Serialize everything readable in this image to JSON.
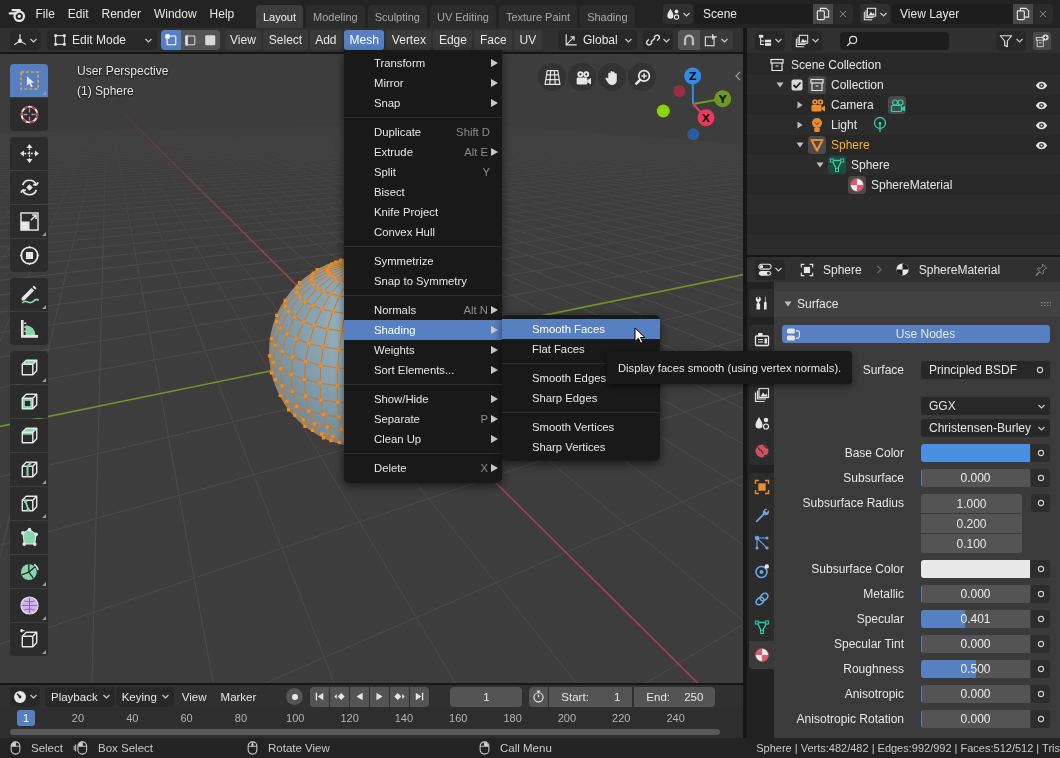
{
  "topbar": {
    "menus": [
      "File",
      "Edit",
      "Render",
      "Window",
      "Help"
    ],
    "workspaces": [
      {
        "label": "Layout",
        "selected": true
      },
      {
        "label": "Modeling",
        "selected": false
      },
      {
        "label": "Sculpting",
        "selected": false
      },
      {
        "label": "UV Editing",
        "selected": false
      },
      {
        "label": "Texture Paint",
        "selected": false
      },
      {
        "label": "Shading",
        "selected": false
      }
    ],
    "scene": "Scene",
    "view_layer": "View Layer"
  },
  "viewport_header": {
    "mode": "Edit Mode",
    "select_modes": [
      {
        "kind": "vertex",
        "selected": true
      },
      {
        "kind": "edge",
        "selected": false
      },
      {
        "kind": "face",
        "selected": false
      }
    ],
    "menus": [
      {
        "label": "View",
        "selected": false
      },
      {
        "label": "Select",
        "selected": false
      },
      {
        "label": "Add",
        "selected": false
      },
      {
        "label": "Mesh",
        "selected": true
      },
      {
        "label": "Vertex",
        "selected": false
      },
      {
        "label": "Edge",
        "selected": false
      },
      {
        "label": "Face",
        "selected": false
      },
      {
        "label": "UV",
        "selected": false
      }
    ],
    "orientation": "Global"
  },
  "viewport": {
    "view_name": "User Perspective",
    "object_name": "(1) Sphere",
    "tool_groups": [
      [
        {
          "kind": "select-box",
          "selected": true
        },
        {
          "kind": "cursor",
          "selected": false
        }
      ],
      [
        {
          "kind": "move",
          "selected": false
        },
        {
          "kind": "rotate",
          "selected": false
        },
        {
          "kind": "scale",
          "selected": false
        },
        {
          "kind": "transform",
          "selected": false
        }
      ],
      [
        {
          "kind": "annotate",
          "selected": false
        },
        {
          "kind": "measure",
          "selected": false
        }
      ],
      [
        {
          "kind": "extrude",
          "selected": false
        },
        {
          "kind": "inset",
          "selected": false
        },
        {
          "kind": "bevel",
          "selected": false
        },
        {
          "kind": "loop-cut",
          "selected": false
        },
        {
          "kind": "knife",
          "selected": false
        },
        {
          "kind": "poly-build",
          "selected": false
        },
        {
          "kind": "spin",
          "selected": false
        },
        {
          "kind": "smooth",
          "selected": false
        },
        {
          "kind": "edge-slide",
          "selected": false
        }
      ]
    ],
    "axes": [
      {
        "label": "Z",
        "color": "#2f8cec"
      },
      {
        "label": "Y",
        "color": "#6a9a1f"
      },
      {
        "label": "X",
        "color": "#f2385a"
      }
    ]
  },
  "mesh_menu": {
    "sections": [
      [
        {
          "label": "Transform",
          "submenu": true,
          "selected": false
        },
        {
          "label": "Mirror",
          "submenu": true,
          "selected": false
        },
        {
          "label": "Snap",
          "submenu": true,
          "selected": false
        }
      ],
      [
        {
          "label": "Duplicate",
          "shortcut": "Shift D",
          "submenu": false,
          "selected": false
        },
        {
          "label": "Extrude",
          "shortcut": "Alt E",
          "submenu": true,
          "selected": false
        },
        {
          "label": "Split",
          "shortcut": "Y",
          "submenu": false,
          "selected": false
        },
        {
          "label": "Bisect",
          "submenu": false,
          "selected": false
        },
        {
          "label": "Knife Project",
          "submenu": false,
          "selected": false
        },
        {
          "label": "Convex Hull",
          "submenu": false,
          "selected": false
        }
      ],
      [
        {
          "label": "Symmetrize",
          "submenu": false,
          "selected": false
        },
        {
          "label": "Snap to Symmetry",
          "submenu": false,
          "selected": false
        }
      ],
      [
        {
          "label": "Normals",
          "shortcut": "Alt N",
          "submenu": true,
          "selected": false
        },
        {
          "label": "Shading",
          "submenu": true,
          "selected": true
        },
        {
          "label": "Weights",
          "submenu": true,
          "selected": false
        },
        {
          "label": "Sort Elements...",
          "submenu": true,
          "selected": false
        }
      ],
      [
        {
          "label": "Show/Hide",
          "submenu": true,
          "selected": false
        },
        {
          "label": "Separate",
          "shortcut": "P",
          "submenu": true,
          "selected": false
        },
        {
          "label": "Clean Up",
          "submenu": true,
          "selected": false
        }
      ],
      [
        {
          "label": "Delete",
          "shortcut": "X",
          "submenu": true,
          "selected": false
        }
      ]
    ]
  },
  "shading_submenu": {
    "sections": [
      [
        {
          "label": "Smooth Faces",
          "selected": true
        },
        {
          "label": "Flat Faces",
          "selected": false
        }
      ],
      [
        {
          "label": "Smooth Edges",
          "selected": false
        },
        {
          "label": "Sharp Edges",
          "selected": false
        }
      ],
      [
        {
          "label": "Smooth Vertices",
          "selected": false
        },
        {
          "label": "Sharp Vertices",
          "selected": false
        }
      ]
    ]
  },
  "tooltip": "Display faces smooth (using vertex normals).",
  "outliner": {
    "tree": [
      {
        "kind": "scene-collection",
        "label": "Scene Collection",
        "selected": false,
        "children": [
          {
            "kind": "collection",
            "label": "Collection",
            "expanded": true,
            "checked": true,
            "selected": false,
            "children": [
              {
                "kind": "camera",
                "label": "Camera",
                "expanded": false,
                "selected": false
              },
              {
                "kind": "light",
                "label": "Light",
                "expanded": false,
                "selected": false
              },
              {
                "kind": "mesh-object",
                "label": "Sphere",
                "expanded": true,
                "selected": true,
                "children": [
                  {
                    "kind": "mesh-data",
                    "label": "Sphere",
                    "expanded": true,
                    "selected": false,
                    "children": [
                      {
                        "kind": "material",
                        "label": "SphereMaterial",
                        "selected": false
                      }
                    ]
                  }
                ]
              }
            ]
          }
        ]
      }
    ]
  },
  "properties": {
    "object": "Sphere",
    "material": "SphereMaterial",
    "tab_groups": [
      [
        {
          "kind": "tool",
          "selected": false
        }
      ],
      [
        {
          "kind": "render",
          "selected": false
        },
        {
          "kind": "view-layer",
          "selected": false
        },
        {
          "kind": "scene",
          "selected": false
        },
        {
          "kind": "world",
          "selected": false
        }
      ],
      [
        {
          "kind": "object",
          "selected": false
        },
        {
          "kind": "modifiers",
          "selected": false
        },
        {
          "kind": "particles",
          "selected": false
        },
        {
          "kind": "physics",
          "selected": false
        },
        {
          "kind": "constraints",
          "selected": false
        },
        {
          "kind": "mesh-data",
          "selected": false
        },
        {
          "kind": "material",
          "selected": true
        }
      ]
    ],
    "panel": {
      "title": "Surface",
      "expanded": true,
      "use_nodes": {
        "label": "Use Nodes",
        "selected": true
      },
      "rows": [
        {
          "kind": "node",
          "label": "Surface",
          "value": "Principled BSDF"
        },
        {
          "kind": "dropdown",
          "value": "GGX"
        },
        {
          "kind": "dropdown",
          "value": "Christensen-Burley"
        },
        {
          "kind": "color",
          "label": "Base Color",
          "color": "#4a90e2"
        },
        {
          "kind": "slider",
          "label": "Subsurface",
          "value": "0.000",
          "level": 0
        },
        {
          "kind": "vector",
          "label": "Subsurface Radius",
          "values": [
            "1.000",
            "0.200",
            "0.100"
          ]
        },
        {
          "kind": "color",
          "label": "Subsurface Color",
          "color": "#e8e8e8"
        },
        {
          "kind": "slider",
          "label": "Metallic",
          "value": "0.000",
          "level": 0
        },
        {
          "kind": "slider",
          "label": "Specular",
          "value": "0.401",
          "level": 0.401
        },
        {
          "kind": "slider",
          "label": "Specular Tint",
          "value": "0.000",
          "level": 0
        },
        {
          "kind": "slider",
          "label": "Roughness",
          "value": "0.500",
          "level": 0.5
        },
        {
          "kind": "slider",
          "label": "Anisotropic",
          "value": "0.000",
          "level": 0
        },
        {
          "kind": "slider",
          "label": "Anisotropic Rotation",
          "value": "0.000",
          "level": 0
        }
      ]
    }
  },
  "timeline": {
    "menus": [
      {
        "kind": "dropdown",
        "label": "Playback"
      },
      {
        "kind": "dropdown",
        "label": "Keying"
      },
      {
        "kind": "menu",
        "label": "View"
      },
      {
        "kind": "menu",
        "label": "Marker"
      }
    ],
    "current_frame": "1",
    "start_label": "Start:",
    "start": "1",
    "end_label": "End:",
    "end": "250",
    "ruler": {
      "current": "1",
      "ticks": [
        "20",
        "40",
        "60",
        "80",
        "100",
        "120",
        "140",
        "160",
        "180",
        "200",
        "220",
        "240"
      ]
    }
  },
  "status_bar": {
    "hints": [
      {
        "kind": "left-click",
        "label": "Select"
      },
      {
        "kind": "left-drag",
        "label": "Box Select"
      },
      {
        "kind": "middle-drag",
        "label": "Rotate View"
      },
      {
        "kind": "right-click",
        "label": "Call Menu"
      }
    ],
    "stats": "Sphere | Verts:482/482 | Edges:992/992 | Faces:512/512 | Tris"
  }
}
